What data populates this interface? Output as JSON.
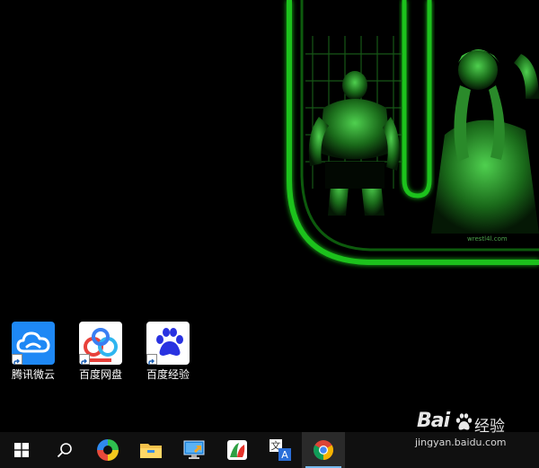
{
  "desktop": {
    "icons": [
      {
        "label": "腾讯微云",
        "icon": "tencent-weiyun-cloud-icon"
      },
      {
        "label": "百度网盘",
        "icon": "baidu-netdisk-icon"
      },
      {
        "label": "百度经验",
        "icon": "baidu-jingyan-paw-icon"
      }
    ]
  },
  "taskbar": {
    "items": [
      {
        "icon": "windows-start-icon"
      },
      {
        "icon": "search-icon"
      },
      {
        "icon": "colorful-app-icon"
      },
      {
        "icon": "file-explorer-icon"
      },
      {
        "icon": "remote-desktop-icon"
      },
      {
        "icon": "red-green-app-icon"
      },
      {
        "icon": "translate-icon"
      },
      {
        "icon": "chrome-icon",
        "active": true
      }
    ]
  },
  "watermark": {
    "brand": "Bai",
    "brand_suffix": "经验",
    "url": "jingyan.baidu.com"
  },
  "colors": {
    "desktop_bg": "#000000",
    "taskbar_bg": "#101010",
    "active_indicator": "#76b9ed",
    "wallpaper_glow": "#1fc21f",
    "weiyun_blue": "#1e88f5",
    "baidu_blue": "#2932e1"
  }
}
